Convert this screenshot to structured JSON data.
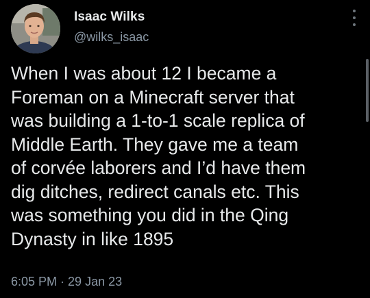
{
  "author": {
    "display_name": "Isaac Wilks",
    "handle": "@wilks_isaac",
    "avatar_icon": "profile-photo"
  },
  "tweet": {
    "lines": [
      "When I was about 12 I became a",
      "Foreman on a Minecraft server that",
      "was building a 1-to-1 scale replica of",
      "Middle Earth. They gave me a team",
      "of corvée laborers and I’d have them",
      "dig ditches, redirect canals etc. This",
      "was something you did in the Qing",
      "Dynasty in like 1895"
    ],
    "time": "6:05 PM",
    "separator": " · ",
    "date": "29 Jan 23"
  },
  "icons": {
    "more": "more-vertical-icon"
  },
  "colors": {
    "background": "#000000",
    "primary_text": "#e7e9ea",
    "secondary_text": "#8b98a5"
  }
}
